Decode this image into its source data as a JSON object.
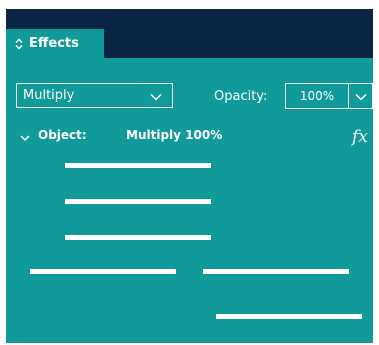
{
  "panel": {
    "tab": {
      "label": "Effects",
      "icon": "chevron-updown-icon"
    },
    "blend_mode": {
      "value": "Multiply",
      "icon": "chevron-down-icon"
    },
    "opacity": {
      "label": "Opacity:",
      "value": "100%",
      "icon": "chevron-down-icon"
    },
    "object_row": {
      "label": "Object:",
      "value": "Multiply 100%",
      "icon": "chevron-down-icon"
    },
    "fx_label": "fx",
    "placeholder_bars": 6
  },
  "colors": {
    "tab_bar": "#0b2545",
    "panel": "#109a9a",
    "text": "#ffffff"
  }
}
